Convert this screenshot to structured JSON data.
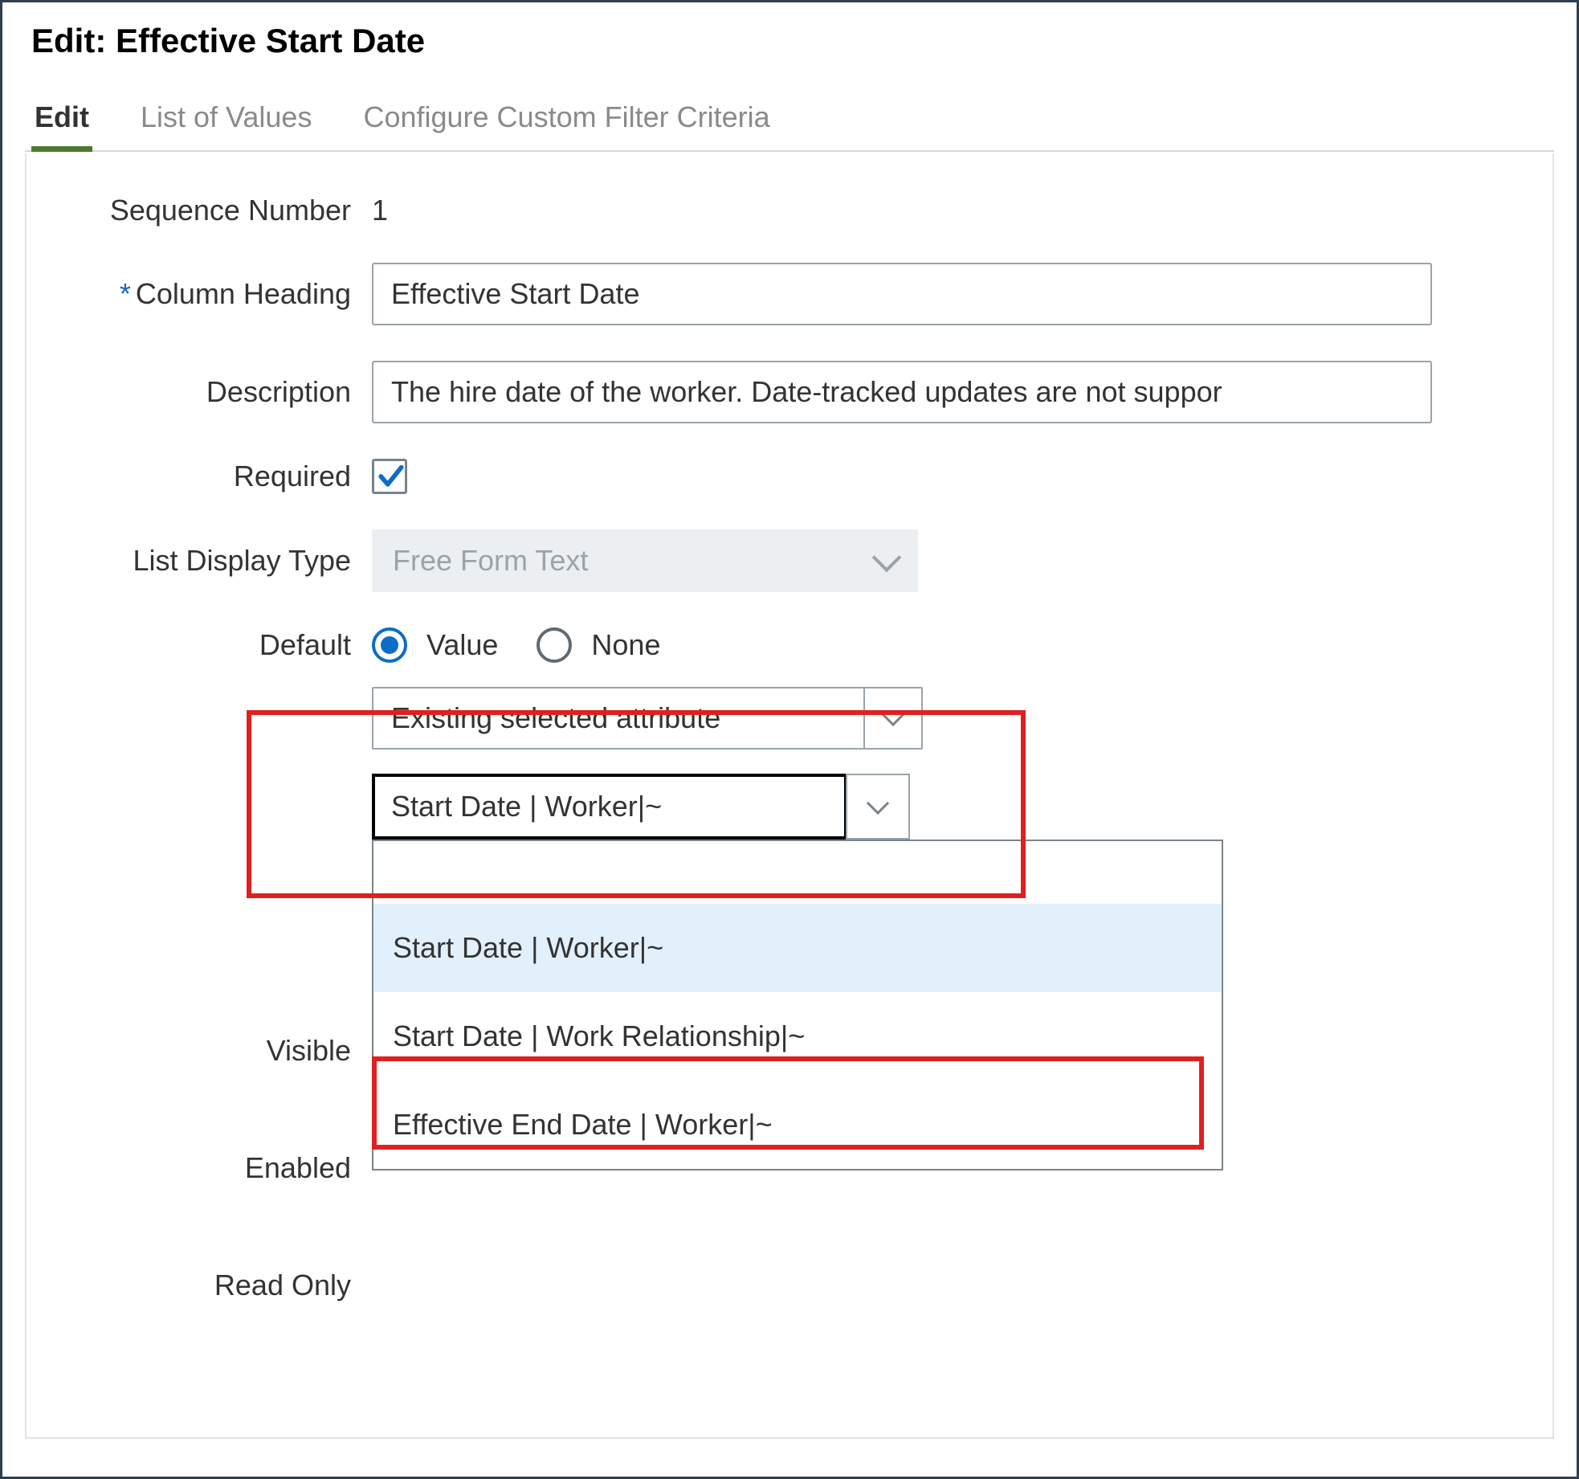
{
  "title": "Edit: Effective Start Date",
  "tabs": {
    "edit": "Edit",
    "lov": "List of Values",
    "filter": "Configure Custom Filter Criteria"
  },
  "fields": {
    "sequence_label": "Sequence Number",
    "sequence_value": "1",
    "column_heading_label": "Column Heading",
    "column_heading_value": "Effective Start Date",
    "description_label": "Description",
    "description_value": "The hire date of the worker. Date-tracked updates are not suppor",
    "required_label": "Required",
    "list_display_label": "List Display Type",
    "list_display_value": "Free Form Text",
    "default_label": "Default",
    "radio_value": "Value",
    "radio_none": "None",
    "default_select_value": "Existing selected attribute",
    "attr_select_value": "Start Date | Worker|~",
    "visible_label": "Visible",
    "enabled_label": "Enabled",
    "readonly_label": "Read Only"
  },
  "options": {
    "blank": " ",
    "o1": "Start Date | Worker|~",
    "o2": "Start Date | Work Relationship|~",
    "o3": "Effective End Date | Worker|~"
  }
}
